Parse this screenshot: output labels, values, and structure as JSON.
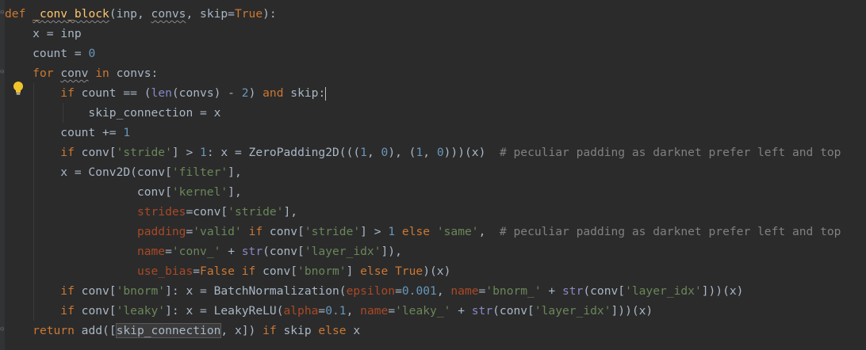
{
  "editor": {
    "lines": [
      [
        {
          "t": "def ",
          "c": "kw"
        },
        {
          "t": "_conv_block",
          "c": "fn squiggle"
        },
        {
          "t": "(inp, "
        },
        {
          "t": "convs",
          "c": "squiggle"
        },
        {
          "t": ", skip="
        },
        {
          "t": "True",
          "c": "kw"
        },
        {
          "t": "):"
        }
      ],
      [
        {
          "t": "    x = inp"
        }
      ],
      [
        {
          "t": "    count = "
        },
        {
          "t": "0",
          "c": "num"
        }
      ],
      [
        {
          "t": "    "
        },
        {
          "t": "for ",
          "c": "kw"
        },
        {
          "t": "conv",
          "c": "squiggle"
        },
        {
          "t": " "
        },
        {
          "t": "in ",
          "c": "kw"
        },
        {
          "t": "convs:"
        }
      ],
      [
        {
          "t": "        "
        },
        {
          "t": "if ",
          "c": "kw"
        },
        {
          "t": "count == ("
        },
        {
          "t": "len",
          "c": "builtin"
        },
        {
          "t": "(convs) - "
        },
        {
          "t": "2",
          "c": "num"
        },
        {
          "t": ") "
        },
        {
          "t": "and ",
          "c": "kw"
        },
        {
          "t": "skip:"
        },
        {
          "t": "",
          "c": "caret"
        }
      ],
      [
        {
          "t": "            skip_connection = x"
        }
      ],
      [
        {
          "t": "        count += "
        },
        {
          "t": "1",
          "c": "num"
        }
      ],
      [
        {
          "t": "        "
        },
        {
          "t": "if ",
          "c": "kw"
        },
        {
          "t": "conv["
        },
        {
          "t": "'stride'",
          "c": "str"
        },
        {
          "t": "] > "
        },
        {
          "t": "1",
          "c": "num"
        },
        {
          "t": ": x = ZeroPadding2D((("
        },
        {
          "t": "1",
          "c": "num"
        },
        {
          "t": ", "
        },
        {
          "t": "0",
          "c": "num"
        },
        {
          "t": "), ("
        },
        {
          "t": "1",
          "c": "num"
        },
        {
          "t": ", "
        },
        {
          "t": "0",
          "c": "num"
        },
        {
          "t": ")))(x)  "
        },
        {
          "t": "# peculiar padding as darknet prefer left and top",
          "c": "comment"
        }
      ],
      [
        {
          "t": "        x = Conv2D(conv["
        },
        {
          "t": "'filter'",
          "c": "str"
        },
        {
          "t": "],"
        }
      ],
      [
        {
          "t": "                   conv["
        },
        {
          "t": "'kernel'",
          "c": "str"
        },
        {
          "t": "],"
        }
      ],
      [
        {
          "t": "                   "
        },
        {
          "t": "strides",
          "c": "param"
        },
        {
          "t": "=conv["
        },
        {
          "t": "'stride'",
          "c": "str"
        },
        {
          "t": "],"
        }
      ],
      [
        {
          "t": "                   "
        },
        {
          "t": "padding",
          "c": "param"
        },
        {
          "t": "="
        },
        {
          "t": "'valid'",
          "c": "str"
        },
        {
          "t": " "
        },
        {
          "t": "if ",
          "c": "kw"
        },
        {
          "t": "conv["
        },
        {
          "t": "'stride'",
          "c": "str"
        },
        {
          "t": "] > "
        },
        {
          "t": "1",
          "c": "num"
        },
        {
          "t": " "
        },
        {
          "t": "else ",
          "c": "kw"
        },
        {
          "t": "'same'",
          "c": "str"
        },
        {
          "t": ",  "
        },
        {
          "t": "# peculiar padding as darknet prefer left and top",
          "c": "comment"
        }
      ],
      [
        {
          "t": "                   "
        },
        {
          "t": "name",
          "c": "param"
        },
        {
          "t": "="
        },
        {
          "t": "'conv_'",
          "c": "str"
        },
        {
          "t": " + "
        },
        {
          "t": "str",
          "c": "builtin"
        },
        {
          "t": "(conv["
        },
        {
          "t": "'layer_idx'",
          "c": "str"
        },
        {
          "t": "]),"
        }
      ],
      [
        {
          "t": "                   "
        },
        {
          "t": "use_bias",
          "c": "param"
        },
        {
          "t": "="
        },
        {
          "t": "False ",
          "c": "kw"
        },
        {
          "t": "if ",
          "c": "kw"
        },
        {
          "t": "conv["
        },
        {
          "t": "'bnorm'",
          "c": "str"
        },
        {
          "t": "] "
        },
        {
          "t": "else ",
          "c": "kw"
        },
        {
          "t": "True",
          "c": "kw"
        },
        {
          "t": ")(x)"
        }
      ],
      [
        {
          "t": "        "
        },
        {
          "t": "if ",
          "c": "kw"
        },
        {
          "t": "conv["
        },
        {
          "t": "'bnorm'",
          "c": "str"
        },
        {
          "t": "]: x = BatchNormalization("
        },
        {
          "t": "epsilon",
          "c": "param"
        },
        {
          "t": "="
        },
        {
          "t": "0.001",
          "c": "num"
        },
        {
          "t": ", "
        },
        {
          "t": "name",
          "c": "param"
        },
        {
          "t": "="
        },
        {
          "t": "'bnorm_'",
          "c": "str"
        },
        {
          "t": " + "
        },
        {
          "t": "str",
          "c": "builtin"
        },
        {
          "t": "(conv["
        },
        {
          "t": "'layer_idx'",
          "c": "str"
        },
        {
          "t": "]))(x)"
        }
      ],
      [
        {
          "t": "        "
        },
        {
          "t": "if ",
          "c": "kw"
        },
        {
          "t": "conv["
        },
        {
          "t": "'leaky'",
          "c": "str"
        },
        {
          "t": "]: x = LeakyReLU("
        },
        {
          "t": "alpha",
          "c": "param"
        },
        {
          "t": "="
        },
        {
          "t": "0.1",
          "c": "num"
        },
        {
          "t": ", "
        },
        {
          "t": "name",
          "c": "param"
        },
        {
          "t": "="
        },
        {
          "t": "'leaky_'",
          "c": "str"
        },
        {
          "t": " + "
        },
        {
          "t": "str",
          "c": "builtin"
        },
        {
          "t": "(conv["
        },
        {
          "t": "'layer_idx'",
          "c": "str"
        },
        {
          "t": "]))(x)"
        }
      ],
      [
        {
          "t": "    "
        },
        {
          "t": "return ",
          "c": "kw"
        },
        {
          "t": "add(["
        },
        {
          "t": "skip_connection",
          "c": "highlight"
        },
        {
          "t": ", x]) "
        },
        {
          "t": "if ",
          "c": "kw"
        },
        {
          "t": "skip "
        },
        {
          "t": "else ",
          "c": "kw"
        },
        {
          "t": "x"
        }
      ]
    ]
  },
  "icons": {
    "intention": "lightbulb-icon"
  },
  "colors": {
    "background": "#2b2b2b",
    "keyword": "#cc7832",
    "function": "#ffc66d",
    "number": "#6897bb",
    "string": "#6a8759",
    "comment": "#808080",
    "builtin": "#8888c6",
    "param": "#aa4926"
  }
}
